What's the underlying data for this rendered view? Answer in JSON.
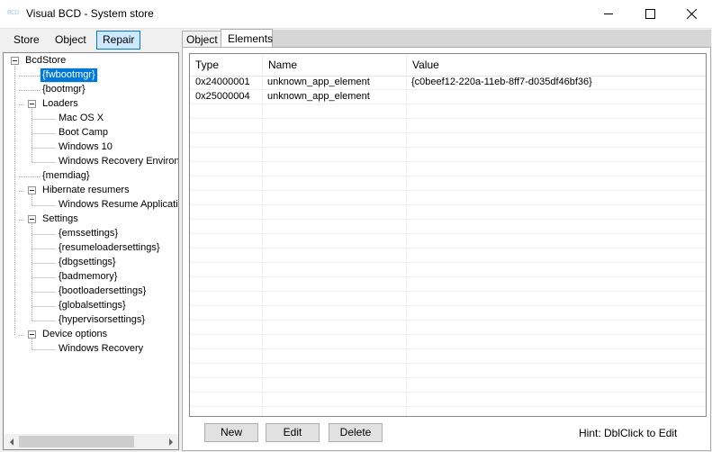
{
  "window": {
    "title": "Visual BCD - System store",
    "app_icon": "BCD",
    "controls": [
      "minimize-icon",
      "maximize-icon",
      "close-icon"
    ]
  },
  "menu": [
    "Store",
    "Object",
    "Repair"
  ],
  "tree": [
    {
      "label": "BcdStore"
    },
    {
      "label": "{fwbootmgr}"
    },
    {
      "label": "{bootmgr}"
    },
    {
      "label": "Loaders"
    },
    {
      "label": "Mac OS X"
    },
    {
      "label": "Boot Camp"
    },
    {
      "label": "Windows 10"
    },
    {
      "label": "Windows Recovery Environ"
    },
    {
      "label": "{memdiag}"
    },
    {
      "label": "Hibernate resumers"
    },
    {
      "label": "Windows Resume Applicati"
    },
    {
      "label": "Settings"
    },
    {
      "label": "{emssettings}"
    },
    {
      "label": "{resumeloadersettings}"
    },
    {
      "label": "{dbgsettings}"
    },
    {
      "label": "{badmemory}"
    },
    {
      "label": "{bootloadersettings}"
    },
    {
      "label": "{globalsettings}"
    },
    {
      "label": "{hypervisorsettings}"
    },
    {
      "label": "Device options"
    },
    {
      "label": "Windows Recovery"
    }
  ],
  "tabs": [
    "Object",
    "Elements"
  ],
  "grid": {
    "columns": [
      "Type",
      "Name",
      "Value"
    ],
    "rows": [
      [
        "0x24000001",
        "unknown_app_element",
        "{c0beef12-220a-11eb-8ff7-d035df46bf36}"
      ],
      [
        "0x25000004",
        "unknown_app_element",
        ""
      ]
    ]
  },
  "buttons": [
    "New",
    "Edit",
    "Delete"
  ],
  "hint": "Hint: DblClick to Edit",
  "colors": {
    "selection": "#0078d7",
    "active_menu_bg": "#cde8ff"
  }
}
